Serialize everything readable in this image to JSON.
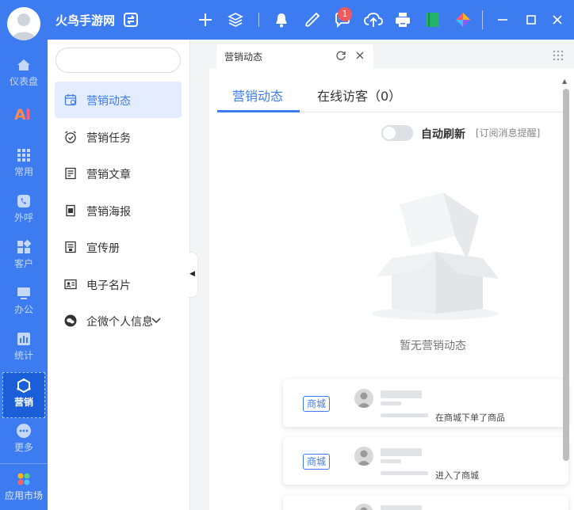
{
  "app": {
    "title": "火鸟手游网"
  },
  "topbar": {
    "notification_count": "1",
    "icons": [
      "swap-icon",
      "plus-icon",
      "layers-icon",
      "bell-icon",
      "phone-icon",
      "chat-icon",
      "cloud-upload-icon",
      "printer-icon",
      "book-icon",
      "app-logo-icon",
      "minimize-icon",
      "maximize-icon",
      "close-icon"
    ]
  },
  "rail": {
    "items": [
      {
        "label": "仪表盘",
        "icon": "home-icon"
      },
      {
        "label": "",
        "icon": "ai-icon"
      },
      {
        "label": "常用",
        "icon": "apps-grid-icon"
      },
      {
        "label": "外呼",
        "icon": "phone-icon"
      },
      {
        "label": "客户",
        "icon": "customer-icon"
      },
      {
        "label": "办公",
        "icon": "monitor-icon"
      },
      {
        "label": "统计",
        "icon": "chart-icon"
      },
      {
        "label": "营销",
        "icon": "marketing-icon"
      },
      {
        "label": "更多",
        "icon": "more-icon"
      },
      {
        "label": "应用市场",
        "icon": "app-market-icon"
      }
    ]
  },
  "sidebar": {
    "search_placeholder": "",
    "items": [
      {
        "label": "营销动态",
        "icon": "calendar-icon"
      },
      {
        "label": "营销任务",
        "icon": "alarm-icon"
      },
      {
        "label": "营销文章",
        "icon": "article-icon"
      },
      {
        "label": "营销海报",
        "icon": "poster-icon"
      },
      {
        "label": "宣传册",
        "icon": "brochure-icon"
      },
      {
        "label": "电子名片",
        "icon": "business-card-icon"
      },
      {
        "label": "企微个人信息",
        "icon": "wechat-work-icon"
      }
    ]
  },
  "tab": {
    "label": "营销动态"
  },
  "main": {
    "tabs": [
      {
        "label": "营销动态"
      },
      {
        "label": "在线访客（0）"
      }
    ],
    "auto_refresh_label": "自动刷新",
    "subscribe_label": "[订阅消息提醒]",
    "empty_text": "暂无营销动态",
    "cards": [
      {
        "tag": "商城",
        "text": "在商城下单了商品"
      },
      {
        "tag": "商城",
        "text": "进入了商城"
      }
    ]
  },
  "colors": {
    "brand": "#3d7cf0",
    "active_bg": "#e3edff",
    "badge": "#f05a5a"
  }
}
